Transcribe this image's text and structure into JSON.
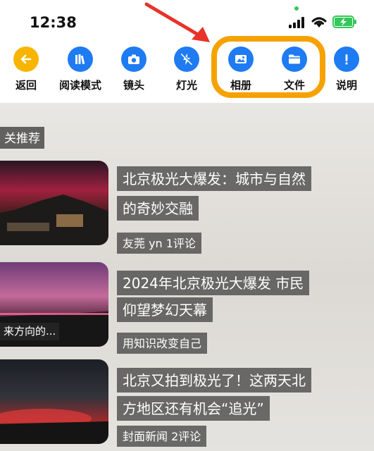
{
  "status_bar": {
    "time": "12:38"
  },
  "toolbar": {
    "items": [
      {
        "label": "返回",
        "icon": "back-arrow-icon",
        "color": "#f7b500"
      },
      {
        "label": "阅读模式",
        "icon": "books-icon",
        "color": "#1e7bf2"
      },
      {
        "label": "镜头",
        "icon": "camera-icon",
        "color": "#1e7bf2"
      },
      {
        "label": "灯光",
        "icon": "flash-off-icon",
        "color": "#1e7bf2"
      },
      {
        "label": "相册",
        "icon": "photo-icon",
        "color": "#1e7bf2"
      },
      {
        "label": "文件",
        "icon": "folder-icon",
        "color": "#1e7bf2"
      },
      {
        "label": "说明",
        "icon": "info-icon",
        "color": "#1e7bf2"
      }
    ],
    "highlight_color": "#f5a200",
    "arrow_color": "#e8322a"
  },
  "content": {
    "section_title": "关推荐",
    "articles": [
      {
        "title_line1": "北京极光大爆发：城市与自然",
        "title_line2": "的奇妙交融",
        "meta": "友莞 yn 1评论"
      },
      {
        "title_line1": "2024年北京极光大爆发 市民",
        "title_line2": "仰望梦幻天幕",
        "meta": "用知识改变自己",
        "thumb_caption": "来方向的..."
      },
      {
        "title_line1": "北京又拍到极光了！这两天北",
        "title_line2": "方地区还有机会“追光”",
        "meta": "封面新闻 2评论"
      }
    ]
  }
}
